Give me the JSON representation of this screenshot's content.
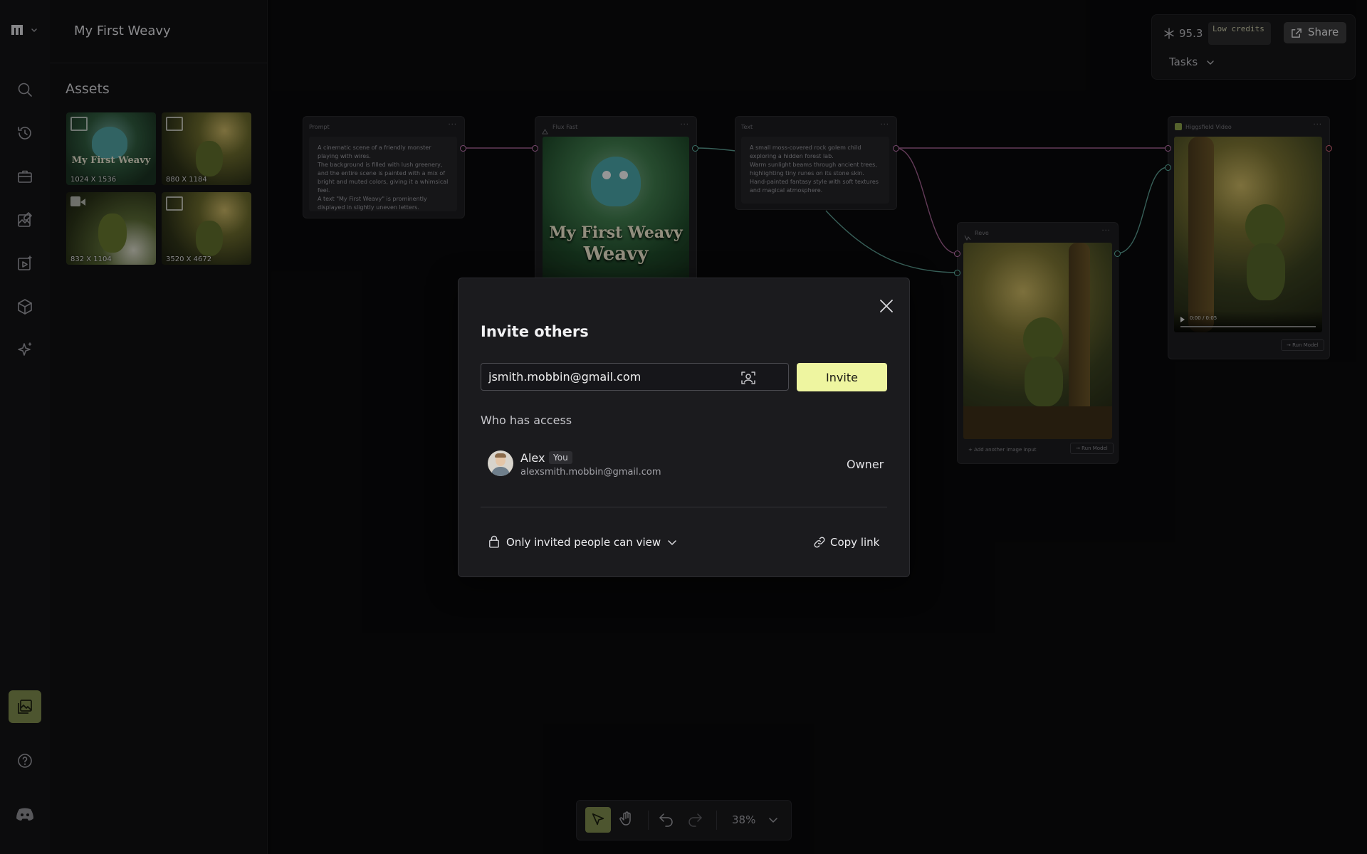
{
  "project": {
    "title": "My First Weavy"
  },
  "assets": {
    "title": "Assets",
    "items": [
      {
        "label": "1024 X 1536",
        "kind": "image",
        "overlay": "My First Weavy"
      },
      {
        "label": "880 X 1184",
        "kind": "image"
      },
      {
        "label": "832 X 1104",
        "kind": "video"
      },
      {
        "label": "3520 X 4672",
        "kind": "image"
      }
    ]
  },
  "canvas": {
    "prompt_node": {
      "title": "Prompt",
      "text": "A cinematic scene of a friendly monster playing with wires.\n The background is filled with lush greenery, and the entire scene is painted with a mix of bright and muted colors, giving it a whimsical feel.\n A text \"My First Weavy\" is prominently displayed in slightly uneven letters."
    },
    "flux_node": {
      "title": "Flux Fast",
      "image_text_1": "My First Weavy",
      "image_text_2": "Weavy"
    },
    "text_node": {
      "title": "Text",
      "text": "A small moss-covered rock golem child exploring a hidden forest lab.\nWarm sunlight beams through ancient trees, highlighting tiny runes on its stone skin.\nHand-painted fantasy style with soft textures and magical atmosphere."
    },
    "reve_node": {
      "title": "Reve",
      "add_input": "+ Add another image input",
      "run": "→ Run Model"
    },
    "video_node": {
      "title": "Higgsfield Video",
      "time": "0:00 / 0:05",
      "run": "→ Run Model"
    }
  },
  "topbar": {
    "credits": "95.3",
    "low_credits": "Low credits",
    "share": "Share",
    "tasks": "Tasks"
  },
  "modal": {
    "title": "Invite others",
    "email_value": "jsmith.mobbin@gmail.com",
    "invite": "Invite",
    "access_title": "Who has access",
    "user": {
      "name": "Alex",
      "badge": "You",
      "email": "alexsmith.mobbin@gmail.com",
      "role": "Owner"
    },
    "visibility": "Only invited people can view",
    "copy_link": "Copy link"
  },
  "toolbar": {
    "zoom": "38%"
  },
  "colors": {
    "accent": "#eef5a0",
    "active_rail": "#7d8a4c",
    "port_pink": "#c878b8",
    "port_teal": "#5fb8a8"
  }
}
